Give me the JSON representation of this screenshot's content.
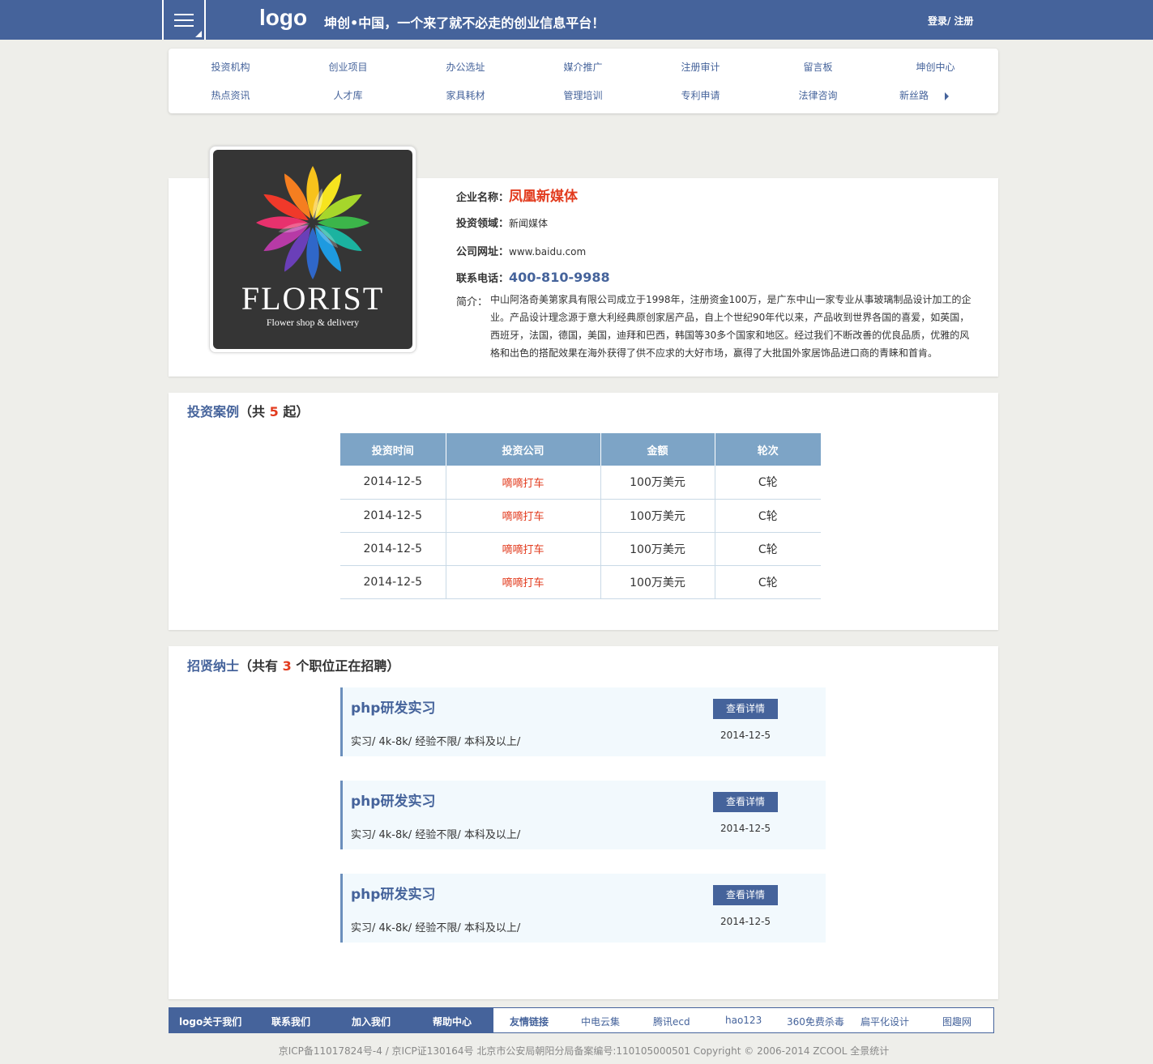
{
  "header": {
    "logo": "logo",
    "slogan": "坤创•中国，一个来了就不必走的创业信息平台！",
    "auth": "登录/ 注册"
  },
  "nav": {
    "row1": [
      "投资机构",
      "创业项目",
      "办公选址",
      "媒介推广",
      "注册审计",
      "留言板",
      "坤创中心"
    ],
    "row2": [
      "热点资讯",
      "人才库",
      "家具耗材",
      "管理培训",
      "专利申请",
      "法律咨询",
      "新丝路"
    ]
  },
  "company": {
    "logo_name": "FLORIST",
    "logo_sub": "Flower shop & delivery",
    "name_label": "企业名称：",
    "name": "凤凰新媒体",
    "field_label": "投资领域：",
    "field": "新闻媒体",
    "site_label": "公司网址：",
    "site": "www.baidu.com",
    "phone_label": "联系电话：",
    "phone": "400-810-9988",
    "intro_label": "简介：",
    "intro": "中山阿洛奇美第家具有限公司成立于1998年，注册资金100万，是广东中山一家专业从事玻璃制品设计加工的企业。产品设计理念源于意大利经典原创家居产品，自上个世纪90年代以来，产品收到世界各国的喜爱，如英国，西班牙，法国，德国，美国，迪拜和巴西，韩国等30多个国家和地区。经过我们不断改善的优良品质，优雅的风格和出色的搭配效果在海外获得了供不应求的大好市场，赢得了大批国外家居饰品进口商的青睐和首肯。"
  },
  "cases": {
    "title": "投资案例",
    "open": "（共",
    "count": "5",
    "close": "起）",
    "headers": [
      "投资时间",
      "投资公司",
      "金额",
      "轮次"
    ],
    "rows": [
      [
        "2014-12-5",
        "嘀嘀打车",
        "100万美元",
        "C轮"
      ],
      [
        "2014-12-5",
        "嘀嘀打车",
        "100万美元",
        "C轮"
      ],
      [
        "2014-12-5",
        "嘀嘀打车",
        "100万美元",
        "C轮"
      ],
      [
        "2014-12-5",
        "嘀嘀打车",
        "100万美元",
        "C轮"
      ]
    ]
  },
  "jobs": {
    "title": "招贤纳士",
    "open": "（共有",
    "count": "3",
    "close": "个职位正在招聘）",
    "items": [
      {
        "title": "php研发实习",
        "meta": "实习/ 4k-8k/ 经验不限/ 本科及以上/",
        "button": "查看详情",
        "date": "2014-12-5"
      },
      {
        "title": "php研发实习",
        "meta": "实习/ 4k-8k/ 经验不限/ 本科及以上/",
        "button": "查看详情",
        "date": "2014-12-5"
      },
      {
        "title": "php研发实习",
        "meta": "实习/ 4k-8k/ 经验不限/ 本科及以上/",
        "button": "查看详情",
        "date": "2014-12-5"
      }
    ]
  },
  "footer": {
    "links": [
      "logo关于我们",
      "联系我们",
      "加入我们",
      "帮助中心"
    ],
    "friends_label": "友情链接",
    "friends": [
      "中电云集",
      "腾讯ecd",
      "hao123",
      "360免费杀毒",
      "扁平化设计",
      "图趣网"
    ],
    "copyright": "京ICP备11017824号-4 / 京ICP证130164号 北京市公安局朝阳分局备案编号:110105000501 Copyright © 2006-2014 ZCOOL 全景统计"
  },
  "colors": {
    "brand": "#45639b",
    "accent_red": "#e23b1e",
    "table_header": "#7da4c6",
    "job_bg": "#f2f9fd"
  }
}
